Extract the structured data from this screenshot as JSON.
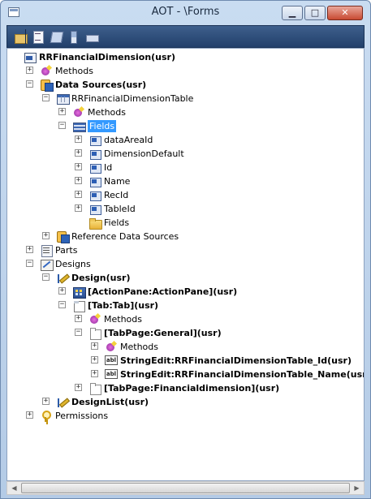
{
  "window": {
    "title": "AOT - \\Forms",
    "minimize_glyph": "▁",
    "maximize_glyph": "□",
    "close_glyph": "✕"
  },
  "toolbar": {
    "buttons": [
      "open-icon",
      "properties-icon",
      "compile-icon",
      "sort-icon",
      "find-icon"
    ]
  },
  "tree": {
    "nodes": [
      {
        "label": "RRFinancialDimension(usr)",
        "bold": true,
        "icon": "form-icon",
        "expander": ""
      },
      {
        "label": "Methods",
        "bold": false,
        "icon": "methods-icon",
        "expander": "+"
      },
      {
        "label": "Data Sources(usr)",
        "bold": true,
        "icon": "datasources-icon",
        "expander": "−"
      },
      {
        "label": "RRFinancialDimensionTable",
        "bold": false,
        "icon": "table-icon",
        "expander": "−"
      },
      {
        "label": "Methods",
        "bold": false,
        "icon": "methods-icon",
        "expander": "+"
      },
      {
        "label": "Fields",
        "bold": false,
        "icon": "fields-icon",
        "expander": "−",
        "selected": true
      },
      {
        "label": "dataAreaId",
        "bold": false,
        "icon": "field-icon",
        "expander": "+"
      },
      {
        "label": "DimensionDefault",
        "bold": false,
        "icon": "field-icon",
        "expander": "+"
      },
      {
        "label": "Id",
        "bold": false,
        "icon": "field-icon",
        "expander": "+"
      },
      {
        "label": "Name",
        "bold": false,
        "icon": "field-icon",
        "expander": "+"
      },
      {
        "label": "RecId",
        "bold": false,
        "icon": "field-icon",
        "expander": "+"
      },
      {
        "label": "TableId",
        "bold": false,
        "icon": "field-icon",
        "expander": "+"
      },
      {
        "label": "Fields",
        "bold": false,
        "icon": "folder-icon",
        "expander": ""
      },
      {
        "label": "Reference Data Sources",
        "bold": false,
        "icon": "datasources-icon",
        "expander": "+"
      },
      {
        "label": "Parts",
        "bold": false,
        "icon": "parts-icon",
        "expander": "+"
      },
      {
        "label": "Designs",
        "bold": false,
        "icon": "designs-icon",
        "expander": "−"
      },
      {
        "label": "Design(usr)",
        "bold": true,
        "icon": "design-icon",
        "expander": "−"
      },
      {
        "label": "[ActionPane:ActionPane](usr)",
        "bold": true,
        "icon": "actionpane-icon",
        "expander": "+"
      },
      {
        "label": "[Tab:Tab](usr)",
        "bold": true,
        "icon": "tab-icon",
        "expander": "−"
      },
      {
        "label": "Methods",
        "bold": false,
        "icon": "methods-icon",
        "expander": "+"
      },
      {
        "label": "[TabPage:General](usr)",
        "bold": true,
        "icon": "tabpage-icon",
        "expander": "−"
      },
      {
        "label": "Methods",
        "bold": false,
        "icon": "methods-icon",
        "expander": "+"
      },
      {
        "label": "StringEdit:RRFinancialDimensionTable_Id(usr)",
        "bold": true,
        "icon": "stringedit-icon",
        "expander": "+"
      },
      {
        "label": "StringEdit:RRFinancialDimensionTable_Name(usr)",
        "bold": true,
        "icon": "stringedit-icon",
        "expander": "+"
      },
      {
        "label": "[TabPage:Financialdimension](usr)",
        "bold": true,
        "icon": "tabpage-icon",
        "expander": "+"
      },
      {
        "label": "DesignList(usr)",
        "bold": true,
        "icon": "design-icon",
        "expander": "+"
      },
      {
        "label": "Permissions",
        "bold": false,
        "icon": "key-icon",
        "expander": "+"
      }
    ]
  },
  "stringedit_icon_text": "abl",
  "scroll": {
    "left_arrow": "◀",
    "right_arrow": "▶"
  }
}
